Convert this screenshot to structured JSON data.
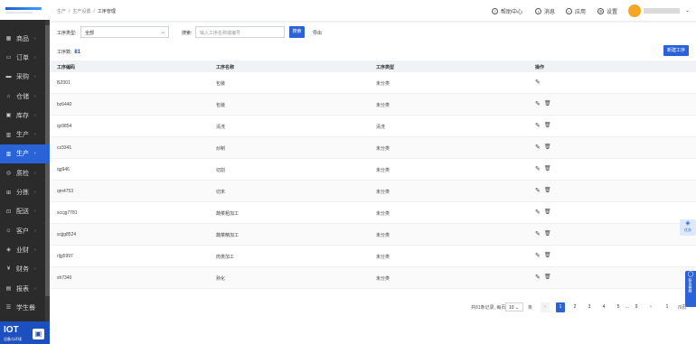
{
  "sidebar": {
    "items": [
      {
        "label": "商品",
        "icon": "grid-icon",
        "active": false
      },
      {
        "label": "订单",
        "icon": "cart-icon",
        "active": false
      },
      {
        "label": "采购",
        "icon": "truck-icon",
        "active": false
      },
      {
        "label": "仓储",
        "icon": "warehouse-icon",
        "active": false
      },
      {
        "label": "库存",
        "icon": "box-icon",
        "active": false
      },
      {
        "label": "生产",
        "icon": "factory-icon",
        "active": false
      },
      {
        "label": "生产",
        "icon": "factory-icon",
        "active": true
      },
      {
        "label": "质检",
        "icon": "check-icon",
        "active": false
      },
      {
        "label": "分拣",
        "icon": "split-icon",
        "active": false
      },
      {
        "label": "配送",
        "icon": "delivery-icon",
        "active": false
      },
      {
        "label": "客户",
        "icon": "user-icon",
        "active": false
      },
      {
        "label": "业财",
        "icon": "finance-icon",
        "active": false
      },
      {
        "label": "财务",
        "icon": "money-icon",
        "active": false
      },
      {
        "label": "报表",
        "icon": "report-icon",
        "active": false
      },
      {
        "label": "学生餐",
        "icon": "meal-icon",
        "active": false
      }
    ],
    "iot": {
      "title": "IOT",
      "subtitle": "设备与环境"
    }
  },
  "header": {
    "breadcrumb": [
      "生产",
      "生产设置",
      "工序管理"
    ],
    "help": "帮助中心",
    "messages": "消息",
    "apps": "应用",
    "settings": "设置"
  },
  "filters": {
    "type_label": "工序类型:",
    "type_value": "全部",
    "search_label": "搜索:",
    "search_placeholder": "输入工序名称或编号",
    "search_button": "搜索",
    "export_button": "导出"
  },
  "main": {
    "count_label": "工序数:",
    "count_value": "81",
    "new_button": "新建工序",
    "columns": [
      "工序编码",
      "工序名称",
      "工序类型",
      "操作"
    ],
    "rows": [
      {
        "code": "BZ001",
        "name": "包装",
        "type": "未分类",
        "deletable": false
      },
      {
        "code": "bz6440",
        "name": "包装",
        "type": "未分类",
        "deletable": true
      },
      {
        "code": "qx9854",
        "name": "清洗",
        "type": "清洗",
        "deletable": true
      },
      {
        "code": "cz3341",
        "name": "炒制",
        "type": "未分类",
        "deletable": true
      },
      {
        "code": "qg946",
        "name": "切割",
        "type": "未分类",
        "deletable": true
      },
      {
        "code": "qm4753",
        "name": "切末",
        "type": "未分类",
        "deletable": true
      },
      {
        "code": "sccjg7781",
        "name": "蔬菜粗加工",
        "type": "未分类",
        "deletable": true
      },
      {
        "code": "scjjg8524",
        "name": "蔬菜精加工",
        "type": "未分类",
        "deletable": true
      },
      {
        "code": "rljg5997",
        "name": "肉类加工",
        "type": "未分类",
        "deletable": true
      },
      {
        "code": "sh7340",
        "name": "熟化",
        "type": "未分类",
        "deletable": true
      }
    ]
  },
  "pagination": {
    "summary": "共81条记录, 每页",
    "page_size": "10",
    "unit": "条",
    "prev": "‹",
    "pages": [
      "1",
      "2",
      "3",
      "4",
      "5",
      "...",
      "9"
    ],
    "next": "›",
    "jump_value": "1",
    "total_pages": "/9页"
  },
  "floating": {
    "task": "任务",
    "contact": "联系客服"
  },
  "colors": {
    "accent": "#2a63d8",
    "sidebar_bg": "#2b2b2b"
  }
}
